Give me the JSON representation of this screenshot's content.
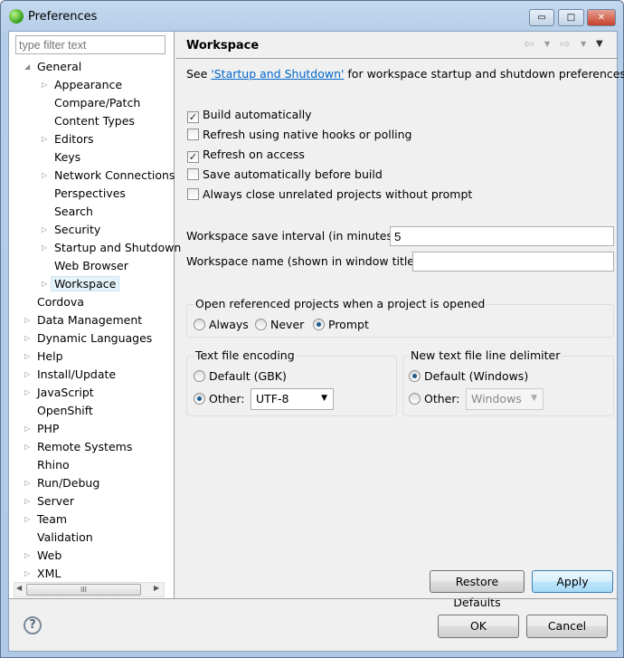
{
  "window": {
    "title": "Preferences",
    "minimize": "▭",
    "maximize": "□",
    "close": "✕"
  },
  "filter": {
    "placeholder": "type filter text"
  },
  "tree": [
    {
      "label": "General",
      "level": 0,
      "expander": "expanded"
    },
    {
      "label": "Appearance",
      "level": 1,
      "expander": "collapsed"
    },
    {
      "label": "Compare/Patch",
      "level": 1,
      "expander": "none"
    },
    {
      "label": "Content Types",
      "level": 1,
      "expander": "none"
    },
    {
      "label": "Editors",
      "level": 1,
      "expander": "collapsed"
    },
    {
      "label": "Keys",
      "level": 1,
      "expander": "none"
    },
    {
      "label": "Network Connections",
      "level": 1,
      "expander": "collapsed"
    },
    {
      "label": "Perspectives",
      "level": 1,
      "expander": "none"
    },
    {
      "label": "Search",
      "level": 1,
      "expander": "none"
    },
    {
      "label": "Security",
      "level": 1,
      "expander": "collapsed"
    },
    {
      "label": "Startup and Shutdown",
      "level": 1,
      "expander": "collapsed"
    },
    {
      "label": "Web Browser",
      "level": 1,
      "expander": "none"
    },
    {
      "label": "Workspace",
      "level": 1,
      "expander": "collapsed",
      "selected": true
    },
    {
      "label": "Cordova",
      "level": 0,
      "expander": "none"
    },
    {
      "label": "Data Management",
      "level": 0,
      "expander": "collapsed"
    },
    {
      "label": "Dynamic Languages",
      "level": 0,
      "expander": "collapsed"
    },
    {
      "label": "Help",
      "level": 0,
      "expander": "collapsed"
    },
    {
      "label": "Install/Update",
      "level": 0,
      "expander": "collapsed"
    },
    {
      "label": "JavaScript",
      "level": 0,
      "expander": "collapsed"
    },
    {
      "label": "OpenShift",
      "level": 0,
      "expander": "none"
    },
    {
      "label": "PHP",
      "level": 0,
      "expander": "collapsed"
    },
    {
      "label": "Remote Systems",
      "level": 0,
      "expander": "collapsed"
    },
    {
      "label": "Rhino",
      "level": 0,
      "expander": "none"
    },
    {
      "label": "Run/Debug",
      "level": 0,
      "expander": "collapsed"
    },
    {
      "label": "Server",
      "level": 0,
      "expander": "collapsed"
    },
    {
      "label": "Team",
      "level": 0,
      "expander": "collapsed"
    },
    {
      "label": "Validation",
      "level": 0,
      "expander": "none"
    },
    {
      "label": "Web",
      "level": 0,
      "expander": "collapsed"
    },
    {
      "label": "XML",
      "level": 0,
      "expander": "collapsed"
    }
  ],
  "page": {
    "title": "Workspace",
    "intro_pre": "See ",
    "intro_link": "'Startup and Shutdown'",
    "intro_post": " for workspace startup and shutdown preferences.",
    "checks": [
      {
        "label": "Build automatically",
        "checked": true
      },
      {
        "label": "Refresh using native hooks or polling",
        "checked": false
      },
      {
        "label": "Refresh on access",
        "checked": true
      },
      {
        "label": "Save automatically before build",
        "checked": false
      },
      {
        "label": "Always close unrelated projects without prompt",
        "checked": false
      }
    ],
    "save_interval_label": "Workspace save interval (in minutes):",
    "save_interval_value": "5",
    "ws_name_label": "Workspace name (shown in window title):",
    "ws_name_value": "",
    "open_ref": {
      "title": "Open referenced projects when a project is opened",
      "options": [
        "Always",
        "Never",
        "Prompt"
      ],
      "selected": "Prompt"
    },
    "encoding": {
      "title": "Text file encoding",
      "default_label": "Default (GBK)",
      "other_label": "Other:",
      "other_value": "UTF-8",
      "selected": "Other"
    },
    "delimiter": {
      "title": "New text file line delimiter",
      "default_label": "Default (Windows)",
      "other_label": "Other:",
      "other_value": "Windows",
      "selected": "Default"
    },
    "restore_defaults": "Restore Defaults",
    "apply": "Apply"
  },
  "footer": {
    "ok": "OK",
    "cancel": "Cancel",
    "help": "?"
  },
  "scroll_thumb": "III"
}
